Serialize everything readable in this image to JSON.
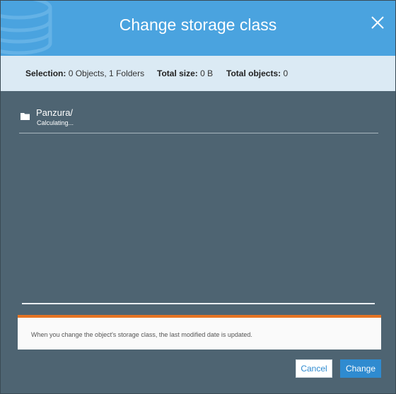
{
  "dialog": {
    "title": "Change storage class",
    "close_icon": "close-icon"
  },
  "summary": {
    "selection_label": "Selection:",
    "selection_value": "0 Objects, 1 Folders",
    "size_label": "Total size:",
    "size_value": "0 B",
    "objects_label": "Total objects:",
    "objects_value": "0"
  },
  "items": [
    {
      "icon": "folder-icon",
      "name": "Panzura/",
      "status": "Calculating..."
    }
  ],
  "notice": {
    "text": "When you change the object's storage class, the last modified date is updated.",
    "accent_color": "#e57424"
  },
  "buttons": {
    "cancel": "Cancel",
    "change": "Change"
  },
  "colors": {
    "header": "#4aa3df",
    "primary": "#2f8bd0",
    "body": "#4e6472"
  }
}
